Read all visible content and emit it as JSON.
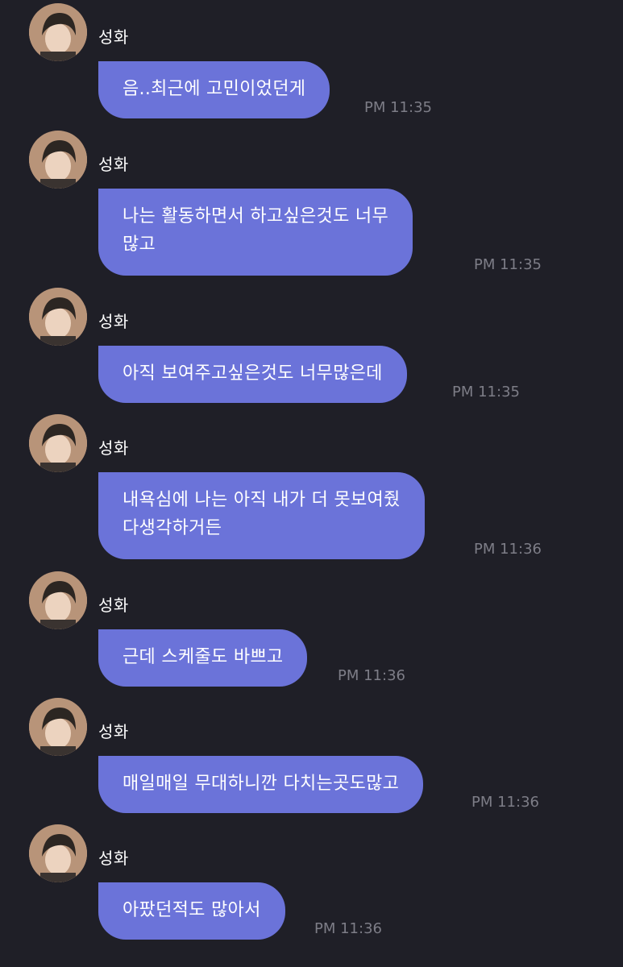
{
  "sender": "성화",
  "messages": [
    {
      "text": "음..최근에 고민이었던게",
      "time": "PM 11:35"
    },
    {
      "text": "나는 활동하면서 하고싶은것도 너무\n많고",
      "time": "PM 11:35"
    },
    {
      "text": "아직 보여주고싶은것도 너무많은데",
      "time": "PM 11:35"
    },
    {
      "text": "내욕심에 나는 아직 내가 더 못보여줬\n다생각하거든",
      "time": "PM 11:36"
    },
    {
      "text": "근데 스케줄도 바쁘고",
      "time": "PM 11:36"
    },
    {
      "text": "매일매일 무대하니깐 다치는곳도많고",
      "time": "PM 11:36"
    },
    {
      "text": "아팠던적도 많아서",
      "time": "PM 11:36"
    }
  ]
}
